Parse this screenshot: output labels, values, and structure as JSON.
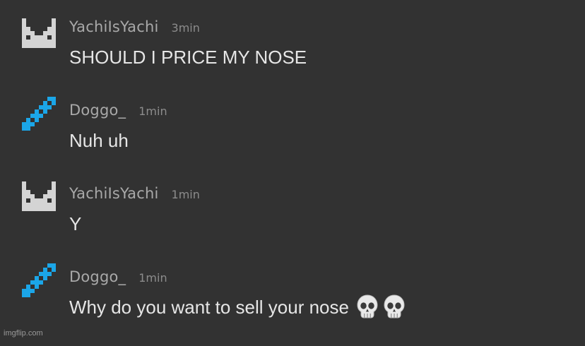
{
  "messages": [
    {
      "username": "YachiIsYachi",
      "time": "3min",
      "text": "SHOULD I PRICE MY NOSE",
      "avatar_icon": "white-pixel-face-icon",
      "emoji": ""
    },
    {
      "username": "Doggo_",
      "time": "1min",
      "text": "Nuh uh",
      "avatar_icon": "blue-pixel-sword-icon",
      "emoji": ""
    },
    {
      "username": "YachiIsYachi",
      "time": "1min",
      "text": "Y",
      "avatar_icon": "white-pixel-face-icon",
      "emoji": ""
    },
    {
      "username": "Doggo_",
      "time": "1min",
      "text": "Why do you want to sell your nose",
      "avatar_icon": "blue-pixel-sword-icon",
      "emoji": "💀💀"
    }
  ],
  "watermark": "imgflip.com",
  "colors": {
    "background": "#323232",
    "username": "#a9a9a9",
    "timestamp": "#8c8c8c",
    "message_text": "#e6e6e6",
    "avatar_white": "#d4d4d4",
    "avatar_blue": "#1ba6e8"
  }
}
